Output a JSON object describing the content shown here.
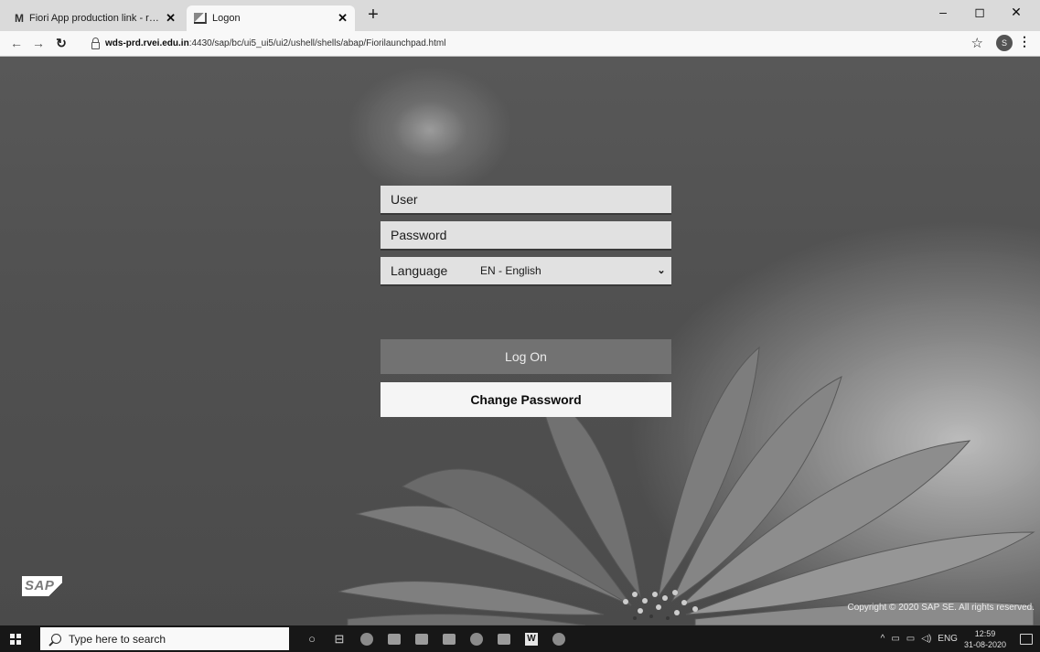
{
  "browser": {
    "tabs": [
      {
        "label": "Fiori App production link - rang",
        "icon": "gmail-icon",
        "active": false
      },
      {
        "label": "Logon",
        "icon": "sap-favicon",
        "active": true
      }
    ],
    "new_tab": "+",
    "url_prefix": "wds-prd.",
    "url_domain": "rvei.edu.in",
    "url_rest": ":4430/sap/bc/ui5_ui5/ui2/ushell/shells/abap/Fiorilaunchpad.html",
    "window_controls": {
      "minimize": "–",
      "maximize": "◻",
      "close": "✕"
    },
    "profile_initial": "S"
  },
  "logon": {
    "user_placeholder": "User",
    "password_placeholder": "Password",
    "language_label": "Language",
    "language_value": "EN - English",
    "logon_button": "Log On",
    "change_password_button": "Change Password"
  },
  "footer": {
    "logo": "SAP",
    "copyright": "Copyright © 2020 SAP SE. All rights reserved."
  },
  "taskbar": {
    "search_placeholder": "Type here to search",
    "language": "ENG",
    "time": "12:59",
    "date": "31-08-2020"
  }
}
